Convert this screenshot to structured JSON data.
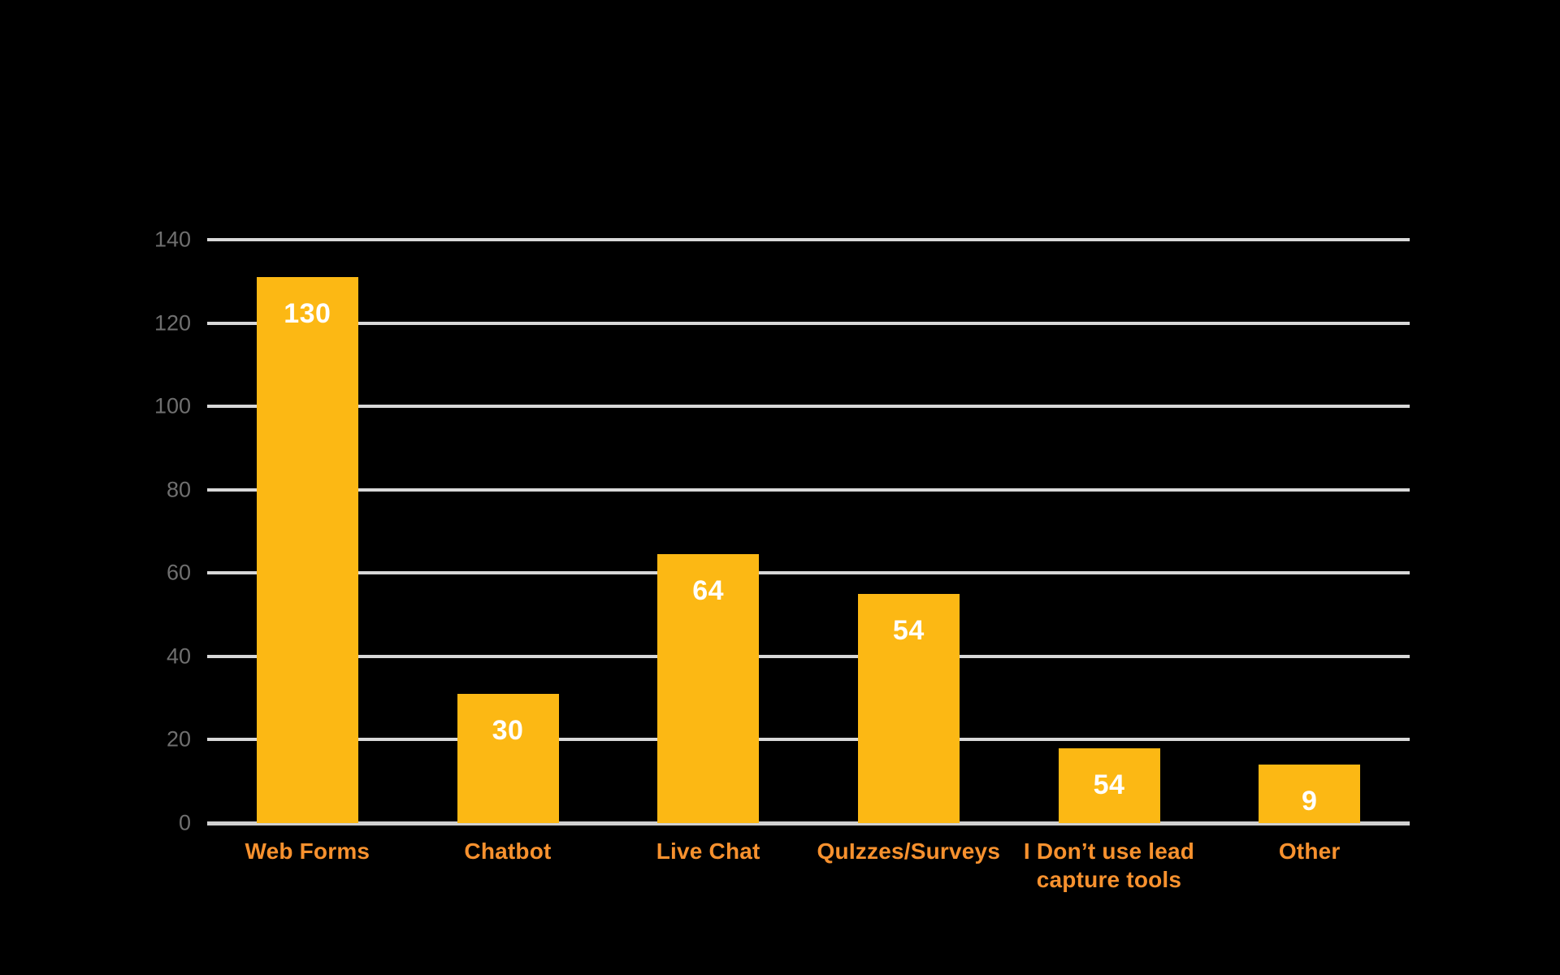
{
  "chart_data": {
    "type": "bar",
    "title": "",
    "subtitle": "",
    "xlabel": "",
    "ylabel": "",
    "ylim": [
      0,
      140
    ],
    "yticks": [
      0,
      20,
      40,
      60,
      80,
      100,
      120,
      140
    ],
    "ytick_labels": [
      "0",
      "20",
      "40",
      "60",
      "80",
      "100",
      "120",
      "140"
    ],
    "grid": true,
    "legend": null,
    "categories": [
      "Web Forms",
      "Chatbot",
      "Live Chat",
      "QuIzzes/Surveys",
      "I Don’t use lead capture tools",
      "Other"
    ],
    "values": [
      130,
      30,
      64,
      54,
      18,
      14
    ],
    "data_labels": [
      "130",
      "30",
      "64",
      "54",
      "54",
      "9"
    ],
    "bars": [
      {
        "category": "Web Forms",
        "label": "130",
        "value": 130,
        "height_value": 131
      },
      {
        "category": "Chatbot",
        "label": "30",
        "value": 30,
        "height_value": 31
      },
      {
        "category": "Live Chat",
        "label": "64",
        "value": 64,
        "height_value": 64.5
      },
      {
        "category": "QuIzzes/Surveys",
        "label": "54",
        "value": 54,
        "height_value": 55
      },
      {
        "category": "I Don’t use lead capture tools",
        "label": "54",
        "value": 54,
        "height_value": 18
      },
      {
        "category": "Other",
        "label": "9",
        "value": 9,
        "height_value": 14
      }
    ],
    "colors": {
      "background": "#000000",
      "bar": "#FCB814",
      "bar_value_text": "#FFFFFF",
      "category_label": "#F7912E",
      "axis_tick_label": "#6F6F6F",
      "gridline": "#D8D8D8",
      "baseline": "#D0D0D0"
    }
  }
}
